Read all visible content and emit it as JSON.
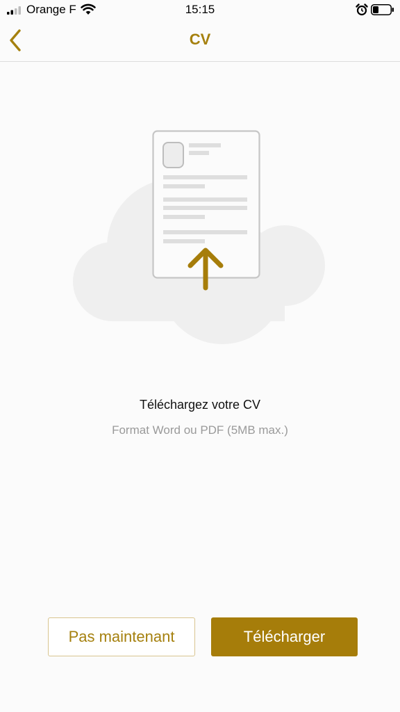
{
  "status_bar": {
    "carrier": "Orange F",
    "time": "15:15",
    "icons": [
      "signal-icon",
      "wifi-icon",
      "alarm-icon",
      "battery-icon"
    ]
  },
  "nav": {
    "title": "CV",
    "back_icon": "chevron-left-icon"
  },
  "illustration": {
    "icons": [
      "cloud-icon",
      "document-icon",
      "upload-arrow-icon"
    ]
  },
  "content": {
    "title": "Téléchargez votre CV",
    "subtitle": "Format Word ou PDF (5MB max.)"
  },
  "actions": {
    "secondary_label": "Pas maintenant",
    "primary_label": "Télécharger"
  },
  "colors": {
    "accent": "#a67d0a",
    "secondary_border": "#d8c48f",
    "subtitle": "#9a9a9a",
    "background": "#fbfbfb"
  }
}
